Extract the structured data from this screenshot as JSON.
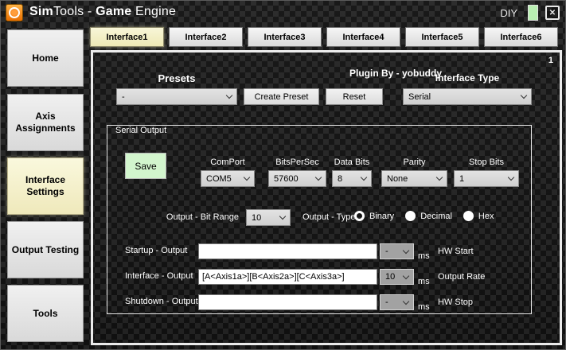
{
  "window": {
    "title_bold1": "Sim",
    "title_rest1": "Tools - ",
    "title_bold2": "Game",
    "title_rest2": " Engine",
    "diy_label": "DIY",
    "close_glyph": "✕"
  },
  "page_indicator": "1",
  "tabs": [
    {
      "label": "Interface1",
      "active": true
    },
    {
      "label": "Interface2",
      "active": false
    },
    {
      "label": "Interface3",
      "active": false
    },
    {
      "label": "Interface4",
      "active": false
    },
    {
      "label": "Interface5",
      "active": false
    },
    {
      "label": "Interface6",
      "active": false
    }
  ],
  "sidebar": {
    "items": [
      {
        "label": "Home",
        "active": false
      },
      {
        "label": "Axis Assignments",
        "active": false
      },
      {
        "label": "Interface Settings",
        "active": true
      },
      {
        "label": "Output Testing",
        "active": false
      },
      {
        "label": "Tools",
        "active": false
      }
    ]
  },
  "presets": {
    "label": "Presets",
    "selected": "-",
    "create_button": "Create Preset",
    "reset_button": "Reset"
  },
  "interface_type": {
    "label": "Interface Type",
    "selected": "Serial"
  },
  "plugin_by": "Plugin By - yobuddy",
  "serial_output": {
    "legend": "Serial Output",
    "save_button": "Save",
    "params": [
      {
        "label": "ComPort",
        "value": "COM5"
      },
      {
        "label": "BitsPerSec",
        "value": "57600"
      },
      {
        "label": "Data Bits",
        "value": "8"
      },
      {
        "label": "Parity",
        "value": "None"
      },
      {
        "label": "Stop Bits",
        "value": "1"
      }
    ],
    "bit_range": {
      "label": "Output - Bit Range",
      "value": "10"
    },
    "output_type": {
      "label": "Output - Type",
      "options": [
        {
          "label": "Binary",
          "selected": true
        },
        {
          "label": "Decimal",
          "selected": false
        },
        {
          "label": "Hex",
          "selected": false
        }
      ]
    },
    "rows": [
      {
        "label": "Startup - Output",
        "value": "",
        "delay": "-",
        "unit": "ms",
        "right_label": "HW Start"
      },
      {
        "label": "Interface - Output",
        "value": "[A<Axis1a>][B<Axis2a>][C<Axis3a>]",
        "delay": "10",
        "unit": "ms",
        "right_label": "Output Rate"
      },
      {
        "label": "Shutdown - Output",
        "value": "",
        "delay": "-",
        "unit": "ms",
        "right_label": "HW Stop"
      }
    ]
  },
  "colors": {
    "active_tab_yellow": "#f2eec0",
    "save_button_green": "#d2f5cd",
    "indicator_green": "#b9efb2",
    "app_icon_orange": "#f08a1e",
    "panel_border": "#ececec"
  }
}
